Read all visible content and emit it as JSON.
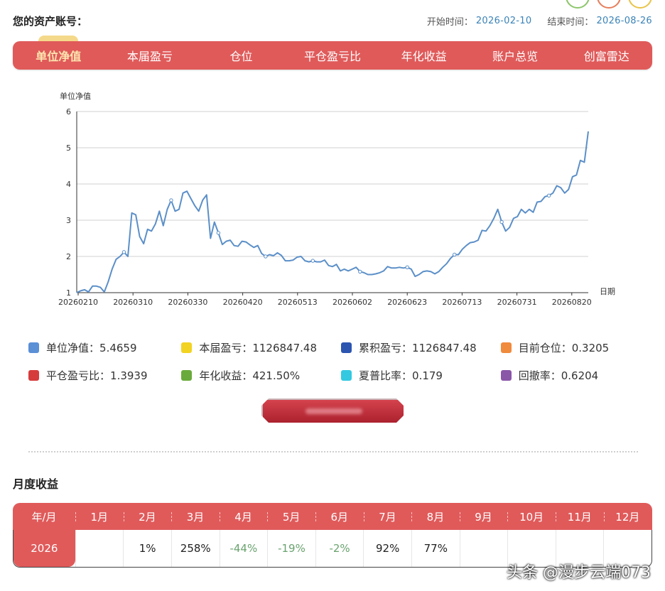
{
  "account": {
    "label": "您的资产账号：",
    "value": ""
  },
  "dates": {
    "start_label": "开始时间：",
    "start": "2026-02-10",
    "end_label": "结束时间：",
    "end": "2026-08-26"
  },
  "tabs": [
    {
      "label": "单位净值",
      "active": true
    },
    {
      "label": "本届盈亏",
      "active": false
    },
    {
      "label": "仓位",
      "active": false
    },
    {
      "label": "平仓盈亏比",
      "active": false
    },
    {
      "label": "年化收益",
      "active": false
    },
    {
      "label": "账户总览",
      "active": false
    },
    {
      "label": "创富雷达",
      "active": false
    }
  ],
  "colors": {
    "accent": "#e05a5a",
    "line": "#5b8fc8",
    "grid": "#d0d0d0"
  },
  "chart_data": {
    "type": "line",
    "ylabel": "单位净值",
    "xlabel": "日期",
    "ylim": [
      1,
      6
    ],
    "yticks": [
      1,
      2,
      3,
      4,
      5,
      6
    ],
    "xticks": [
      "20260210",
      "20260310",
      "20260330",
      "20260420",
      "20260513",
      "20260602",
      "20260623",
      "20260713",
      "20260731",
      "20260820"
    ],
    "series": [
      {
        "values": [
          1.0,
          1.05,
          1.08,
          1.02,
          1.18,
          1.18,
          1.15,
          1.02,
          1.3,
          1.65,
          1.92,
          2.0,
          2.12,
          2.0,
          3.2,
          3.15,
          2.55,
          2.35,
          2.75,
          2.7,
          2.9,
          3.25,
          2.85,
          3.3,
          3.55,
          3.25,
          3.3,
          3.75,
          3.8,
          3.6,
          3.4,
          3.25,
          3.55,
          3.7,
          2.5,
          2.95,
          2.65,
          2.33,
          2.42,
          2.45,
          2.3,
          2.28,
          2.42,
          2.4,
          2.32,
          2.25,
          2.3,
          2.08,
          2.0,
          2.05,
          2.02,
          2.1,
          2.03,
          1.88,
          1.88,
          1.9,
          1.98,
          2.0,
          1.88,
          1.85,
          1.88,
          1.85,
          1.85,
          1.9,
          1.75,
          1.72,
          1.78,
          1.6,
          1.65,
          1.6,
          1.65,
          1.7,
          1.58,
          1.55,
          1.5,
          1.5,
          1.52,
          1.55,
          1.6,
          1.72,
          1.68,
          1.68,
          1.7,
          1.68,
          1.7,
          1.65,
          1.45,
          1.5,
          1.58,
          1.6,
          1.58,
          1.52,
          1.58,
          1.7,
          1.8,
          1.95,
          2.05,
          2.05,
          2.2,
          2.3,
          2.38,
          2.4,
          2.45,
          2.72,
          2.7,
          2.85,
          3.05,
          3.3,
          2.95,
          2.7,
          2.8,
          3.05,
          3.1,
          3.3,
          3.2,
          3.3,
          3.22,
          3.5,
          3.52,
          3.65,
          3.68,
          3.75,
          3.95,
          3.9,
          3.75,
          3.85,
          4.2,
          4.25,
          4.65,
          4.6,
          5.45
        ]
      }
    ]
  },
  "legend": [
    {
      "name": "单位净值",
      "value": "5.4659",
      "color": "#5b8fd6"
    },
    {
      "name": "本届盈亏",
      "value": "1126847.48",
      "color": "#f2d321"
    },
    {
      "name": "累积盈亏",
      "value": "1126847.48",
      "color": "#2c55b0"
    },
    {
      "name": "目前仓位",
      "value": "0.3205",
      "color": "#f08a3c"
    },
    {
      "name": "平仓盈亏比",
      "value": "1.3939",
      "color": "#d63c3c"
    },
    {
      "name": "年化收益",
      "value": "421.50%",
      "color": "#6aaa3c"
    },
    {
      "name": "夏普比率",
      "value": "0.179",
      "color": "#34c9e0"
    },
    {
      "name": "回撤率",
      "value": "0.6204",
      "color": "#8a56a8"
    }
  ],
  "action_button": {
    "label": ""
  },
  "monthly": {
    "title": "月度收益",
    "header": [
      "年/月",
      "1月",
      "2月",
      "3月",
      "4月",
      "5月",
      "6月",
      "7月",
      "8月",
      "9月",
      "10月",
      "11月",
      "12月"
    ],
    "rows": [
      {
        "year": "2026",
        "values": [
          "",
          "1%",
          "258%",
          "-44%",
          "-19%",
          "-2%",
          "92%",
          "77%",
          "",
          "",
          "",
          ""
        ]
      }
    ]
  },
  "watermark": "头条 @漫步云端073"
}
